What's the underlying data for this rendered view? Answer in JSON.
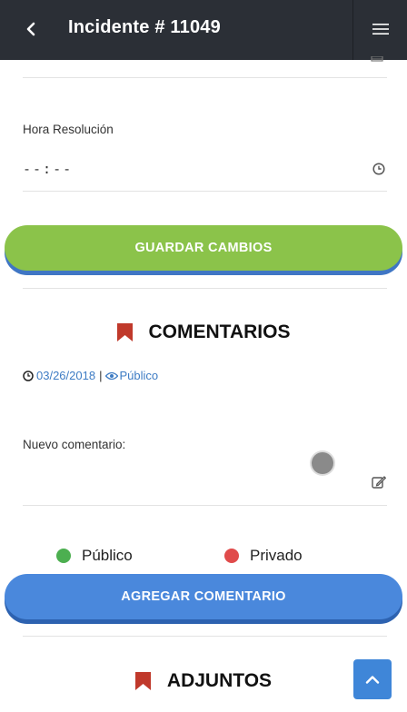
{
  "header": {
    "title": "Incidente # 11049",
    "back_icon": "chevron-left-icon",
    "menu_icon": "hamburger-menu-icon"
  },
  "form": {
    "hora_resolucion_label": "Hora Resolución",
    "hora_resolucion_value": "--:--",
    "save_button": "GUARDAR CAMBIOS"
  },
  "comments": {
    "title": "COMENTARIOS",
    "entry_date": "03/26/2018",
    "entry_separator": "|",
    "entry_visibility": "Público",
    "new_comment_label": "Nuevo comentario:",
    "visibility_options": [
      {
        "label": "Público",
        "color": "#4caf50"
      },
      {
        "label": "Privado",
        "color": "#e04b4b"
      }
    ],
    "add_button": "AGREGAR COMENTARIO"
  },
  "attachments": {
    "title": "ADJUNTOS"
  },
  "colors": {
    "header_bg": "#2b2f36",
    "save_green": "#8bc34a",
    "primary_blue": "#4a88dc",
    "bookmark_red": "#c0392b",
    "link_blue": "#3e7cc4"
  }
}
